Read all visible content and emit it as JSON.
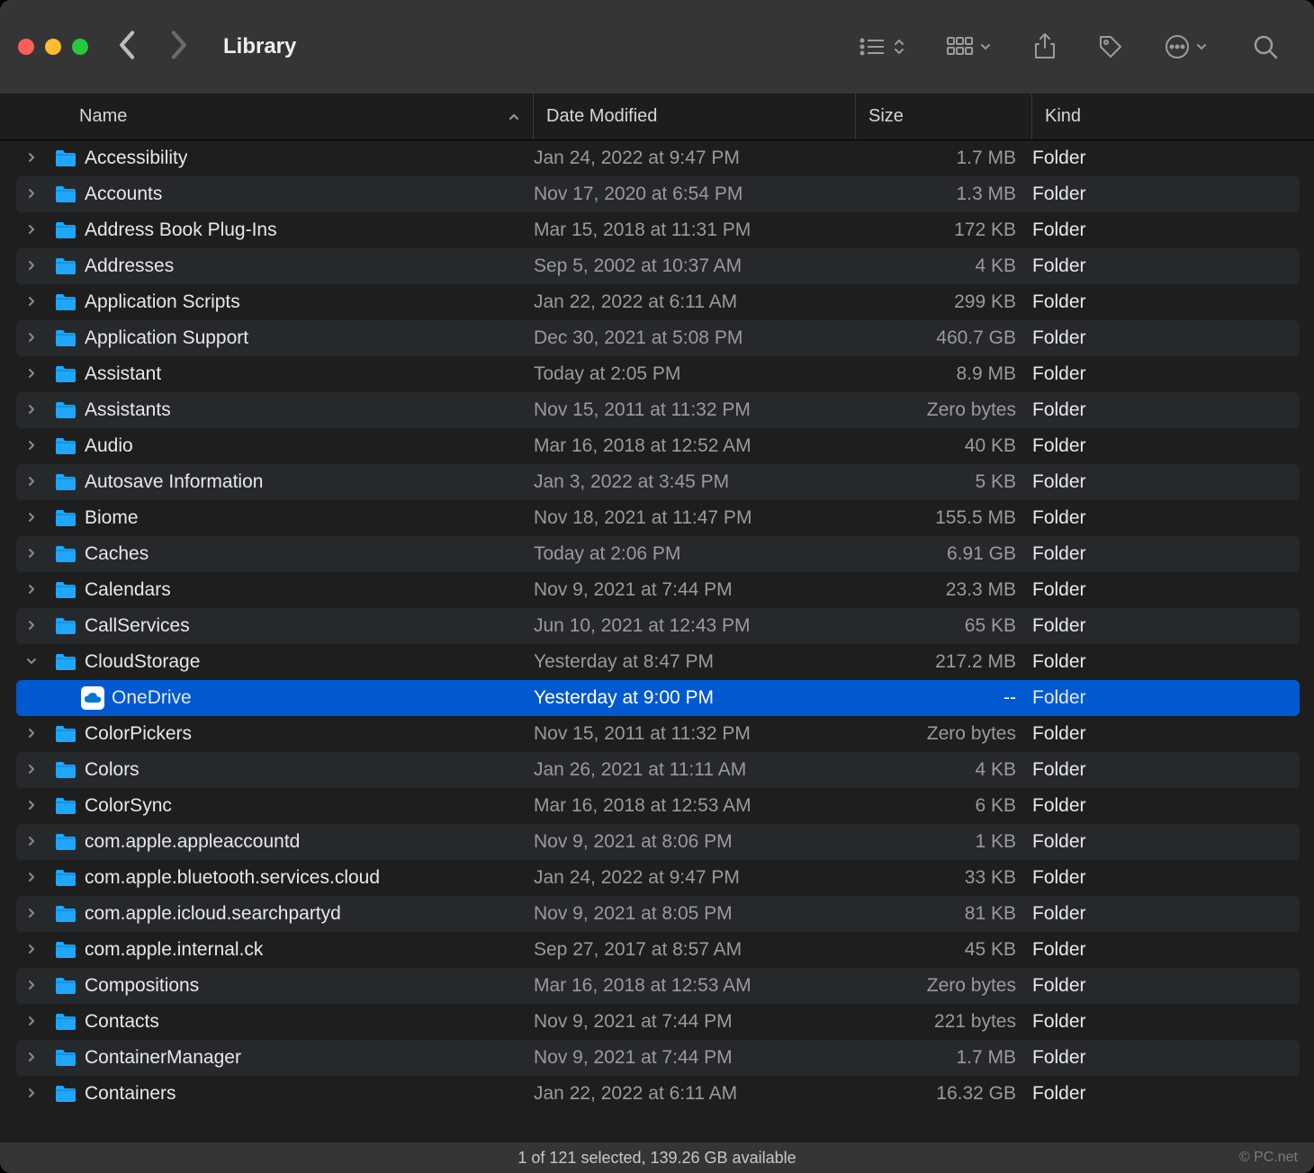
{
  "window": {
    "title": "Library"
  },
  "columns": {
    "name": "Name",
    "date": "Date Modified",
    "size": "Size",
    "kind": "Kind"
  },
  "status": "1 of 121 selected, 139.26 GB available",
  "watermark": "© PC.net",
  "icons": {
    "back": "chevron-left-icon",
    "forward": "chevron-right-icon",
    "view": "list-view-icon",
    "group": "group-icon",
    "share": "share-icon",
    "tag": "tag-icon",
    "more": "more-icon",
    "search": "search-icon"
  },
  "rows": [
    {
      "name": "Accessibility",
      "date": "Jan 24, 2022 at 9:47 PM",
      "size": "1.7 MB",
      "kind": "Folder",
      "icon": "folder",
      "indent": 0,
      "expanded": false
    },
    {
      "name": "Accounts",
      "date": "Nov 17, 2020 at 6:54 PM",
      "size": "1.3 MB",
      "kind": "Folder",
      "icon": "folder",
      "indent": 0,
      "expanded": false
    },
    {
      "name": "Address Book Plug-Ins",
      "date": "Mar 15, 2018 at 11:31 PM",
      "size": "172 KB",
      "kind": "Folder",
      "icon": "folder",
      "indent": 0,
      "expanded": false
    },
    {
      "name": "Addresses",
      "date": "Sep 5, 2002 at 10:37 AM",
      "size": "4 KB",
      "kind": "Folder",
      "icon": "folder",
      "indent": 0,
      "expanded": false
    },
    {
      "name": "Application Scripts",
      "date": "Jan 22, 2022 at 6:11 AM",
      "size": "299 KB",
      "kind": "Folder",
      "icon": "folder",
      "indent": 0,
      "expanded": false
    },
    {
      "name": "Application Support",
      "date": "Dec 30, 2021 at 5:08 PM",
      "size": "460.7 GB",
      "kind": "Folder",
      "icon": "folder",
      "indent": 0,
      "expanded": false
    },
    {
      "name": "Assistant",
      "date": "Today at 2:05 PM",
      "size": "8.9 MB",
      "kind": "Folder",
      "icon": "folder",
      "indent": 0,
      "expanded": false
    },
    {
      "name": "Assistants",
      "date": "Nov 15, 2011 at 11:32 PM",
      "size": "Zero bytes",
      "kind": "Folder",
      "icon": "folder",
      "indent": 0,
      "expanded": false
    },
    {
      "name": "Audio",
      "date": "Mar 16, 2018 at 12:52 AM",
      "size": "40 KB",
      "kind": "Folder",
      "icon": "folder",
      "indent": 0,
      "expanded": false
    },
    {
      "name": "Autosave Information",
      "date": "Jan 3, 2022 at 3:45 PM",
      "size": "5 KB",
      "kind": "Folder",
      "icon": "folder",
      "indent": 0,
      "expanded": false
    },
    {
      "name": "Biome",
      "date": "Nov 18, 2021 at 11:47 PM",
      "size": "155.5 MB",
      "kind": "Folder",
      "icon": "folder",
      "indent": 0,
      "expanded": false
    },
    {
      "name": "Caches",
      "date": "Today at 2:06 PM",
      "size": "6.91 GB",
      "kind": "Folder",
      "icon": "folder",
      "indent": 0,
      "expanded": false
    },
    {
      "name": "Calendars",
      "date": "Nov 9, 2021 at 7:44 PM",
      "size": "23.3 MB",
      "kind": "Folder",
      "icon": "folder",
      "indent": 0,
      "expanded": false
    },
    {
      "name": "CallServices",
      "date": "Jun 10, 2021 at 12:43 PM",
      "size": "65 KB",
      "kind": "Folder",
      "icon": "folder",
      "indent": 0,
      "expanded": false
    },
    {
      "name": "CloudStorage",
      "date": "Yesterday at 8:47 PM",
      "size": "217.2 MB",
      "kind": "Folder",
      "icon": "folder",
      "indent": 0,
      "expanded": true
    },
    {
      "name": "OneDrive",
      "date": "Yesterday at 9:00 PM",
      "size": "--",
      "kind": "Folder",
      "icon": "onedrive",
      "indent": 1,
      "expanded": false,
      "selected": true,
      "noDisclosure": true
    },
    {
      "name": "ColorPickers",
      "date": "Nov 15, 2011 at 11:32 PM",
      "size": "Zero bytes",
      "kind": "Folder",
      "icon": "folder",
      "indent": 0,
      "expanded": false
    },
    {
      "name": "Colors",
      "date": "Jan 26, 2021 at 11:11 AM",
      "size": "4 KB",
      "kind": "Folder",
      "icon": "folder",
      "indent": 0,
      "expanded": false
    },
    {
      "name": "ColorSync",
      "date": "Mar 16, 2018 at 12:53 AM",
      "size": "6 KB",
      "kind": "Folder",
      "icon": "folder",
      "indent": 0,
      "expanded": false
    },
    {
      "name": "com.apple.appleaccountd",
      "date": "Nov 9, 2021 at 8:06 PM",
      "size": "1 KB",
      "kind": "Folder",
      "icon": "folder",
      "indent": 0,
      "expanded": false
    },
    {
      "name": "com.apple.bluetooth.services.cloud",
      "date": "Jan 24, 2022 at 9:47 PM",
      "size": "33 KB",
      "kind": "Folder",
      "icon": "folder",
      "indent": 0,
      "expanded": false
    },
    {
      "name": "com.apple.icloud.searchpartyd",
      "date": "Nov 9, 2021 at 8:05 PM",
      "size": "81 KB",
      "kind": "Folder",
      "icon": "folder",
      "indent": 0,
      "expanded": false
    },
    {
      "name": "com.apple.internal.ck",
      "date": "Sep 27, 2017 at 8:57 AM",
      "size": "45 KB",
      "kind": "Folder",
      "icon": "folder",
      "indent": 0,
      "expanded": false
    },
    {
      "name": "Compositions",
      "date": "Mar 16, 2018 at 12:53 AM",
      "size": "Zero bytes",
      "kind": "Folder",
      "icon": "folder",
      "indent": 0,
      "expanded": false
    },
    {
      "name": "Contacts",
      "date": "Nov 9, 2021 at 7:44 PM",
      "size": "221 bytes",
      "kind": "Folder",
      "icon": "folder",
      "indent": 0,
      "expanded": false
    },
    {
      "name": "ContainerManager",
      "date": "Nov 9, 2021 at 7:44 PM",
      "size": "1.7 MB",
      "kind": "Folder",
      "icon": "folder",
      "indent": 0,
      "expanded": false
    },
    {
      "name": "Containers",
      "date": "Jan 22, 2022 at 6:11 AM",
      "size": "16.32 GB",
      "kind": "Folder",
      "icon": "folder",
      "indent": 0,
      "expanded": false
    }
  ]
}
